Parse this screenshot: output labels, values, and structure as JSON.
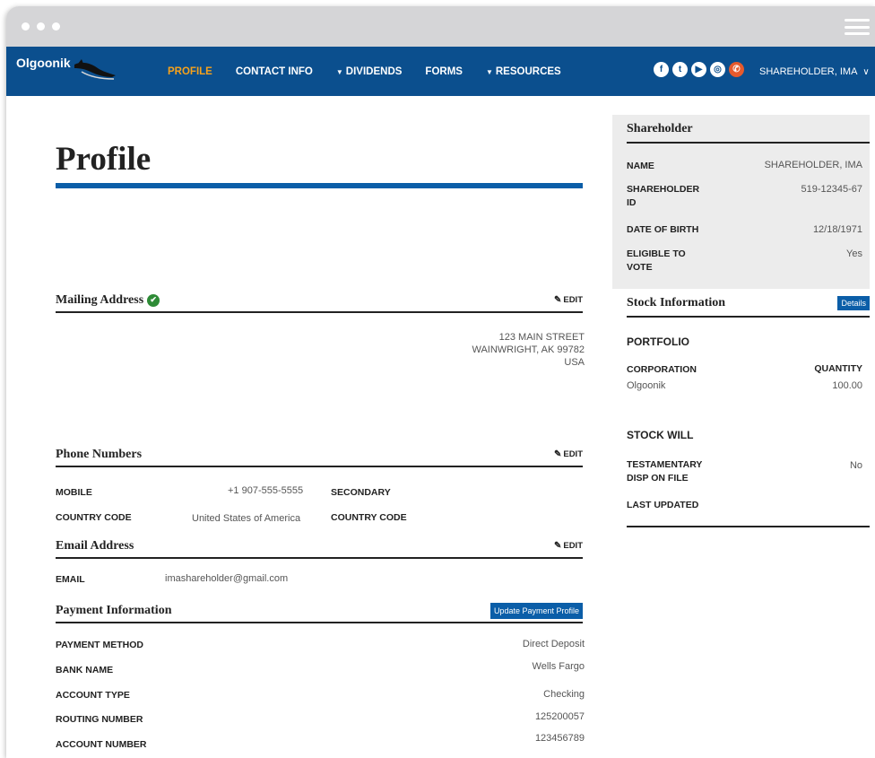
{
  "brand": {
    "name": "Olgoonik"
  },
  "nav": {
    "items": [
      {
        "label": "PROFILE",
        "caret": false
      },
      {
        "label": "CONTACT INFO",
        "caret": false
      },
      {
        "label": "DIVIDENDS",
        "caret": true
      },
      {
        "label": "FORMS",
        "caret": false
      },
      {
        "label": "RESOURCES",
        "caret": true
      }
    ],
    "user": "SHAREHOLDER, IMA",
    "socials": [
      "facebook-icon",
      "twitter-icon",
      "youtube-icon",
      "instagram-icon",
      "phone-icon"
    ]
  },
  "colors": {
    "navbar": "#0b4f8e",
    "accent": "#f7a21b",
    "rule": "#0b5ea8",
    "check": "#2e8b36"
  },
  "page": {
    "title": "Profile"
  },
  "mailing": {
    "title": "Mailing Address",
    "edit": "EDIT",
    "line1": "123 MAIN STREET",
    "line2": "WAINWRIGHT, AK 99782",
    "line3": "USA"
  },
  "phones": {
    "title": "Phone Numbers",
    "edit": "EDIT",
    "mobile_label": "MOBILE",
    "mobile_value": "+1 907-555-5555",
    "secondary_label": "SECONDARY",
    "country_label": "COUNTRY CODE",
    "country_value": "United States of America",
    "country2_label": "COUNTRY CODE"
  },
  "email": {
    "title": "Email Address",
    "edit": "EDIT",
    "label": "EMAIL",
    "value": "imashareholder@gmail.com"
  },
  "payment": {
    "title": "Payment Information",
    "button": "Update Payment Profile",
    "rows": [
      {
        "label": "PAYMENT METHOD",
        "value": "Direct Deposit"
      },
      {
        "label": "BANK NAME",
        "value": "Wells Fargo"
      },
      {
        "label": "ACCOUNT TYPE",
        "value": "Checking"
      },
      {
        "label": "ROUTING NUMBER",
        "value": "125200057"
      },
      {
        "label": "ACCOUNT NUMBER",
        "value": "123456789"
      }
    ]
  },
  "shareholder": {
    "title": "Shareholder",
    "name_label": "NAME",
    "name_value": "SHAREHOLDER, IMA",
    "id_label_1": "SHAREHOLDER",
    "id_label_2": "ID",
    "id_value": "519-12345-67",
    "dob_label": "DATE OF BIRTH",
    "dob_value": "12/18/1971",
    "vote_label_1": "ELIGIBLE TO",
    "vote_label_2": "VOTE",
    "vote_value": "Yes"
  },
  "stock": {
    "title": "Stock Information",
    "details": "Details",
    "portfolio": "PORTFOLIO",
    "corp_label": "CORPORATION",
    "qty_label": "QUANTITY",
    "corp_value": "Olgoonik",
    "qty_value": "100.00",
    "will_title": "STOCK WILL",
    "testamentary_label_1": "TESTAMENTARY",
    "testamentary_label_2": "DISP ON FILE",
    "testamentary_value": "No",
    "last_updated_label": "LAST UPDATED"
  }
}
